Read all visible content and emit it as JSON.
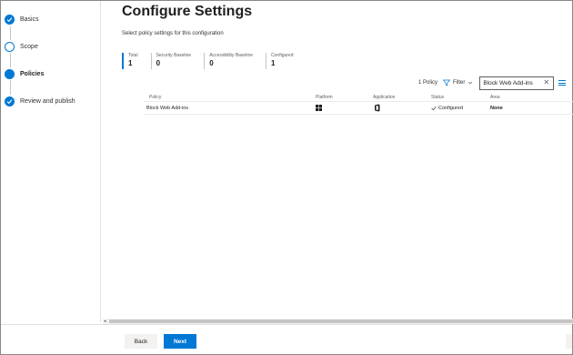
{
  "wizard": {
    "steps": [
      {
        "label": "Basics",
        "state": "done"
      },
      {
        "label": "Scope",
        "state": "open"
      },
      {
        "label": "Policies",
        "state": "current"
      },
      {
        "label": "Review and publish",
        "state": "done"
      }
    ]
  },
  "page": {
    "title": "Configure Settings",
    "subtitle": "Select policy settings for this configuration"
  },
  "stats": [
    {
      "label": "Total",
      "value": "1"
    },
    {
      "label": "Security Baseline",
      "value": "0"
    },
    {
      "label": "Accessibility Baseline",
      "value": "0"
    },
    {
      "label": "Configured",
      "value": "1"
    }
  ],
  "toolbar": {
    "count": "1 Policy",
    "filter_label": "Filter",
    "search_value": "Block Web Add-ins"
  },
  "table": {
    "columns": [
      "Policy",
      "Platform",
      "Application",
      "Status",
      "Area"
    ],
    "rows": [
      {
        "policy": "Block Web Add-ins",
        "platform_icon": "windows-icon",
        "application_icon": "office-icon",
        "status": "Configured",
        "area": "None"
      }
    ]
  },
  "footer": {
    "back_label": "Back",
    "next_label": "Next"
  },
  "colors": {
    "accent": "#0078d4",
    "border": "#e1dfdd"
  }
}
